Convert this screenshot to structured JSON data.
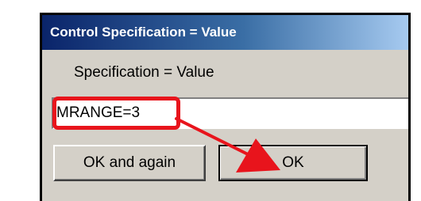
{
  "dialog": {
    "title": "Control Specification = Value",
    "prompt_label": "Specification = Value",
    "input_value": "MRANGE=3",
    "buttons": {
      "ok_and_again_label": "OK and again",
      "ok_label": "OK"
    }
  },
  "annotation": {
    "highlight_color": "#e8141c",
    "arrow_color": "#e8141c",
    "points_from": "input-field",
    "points_to": "ok-button"
  },
  "colors": {
    "titlebar_start": "#0a246a",
    "titlebar_end": "#a6caf0",
    "dialog_face": "#d4d0c8"
  }
}
